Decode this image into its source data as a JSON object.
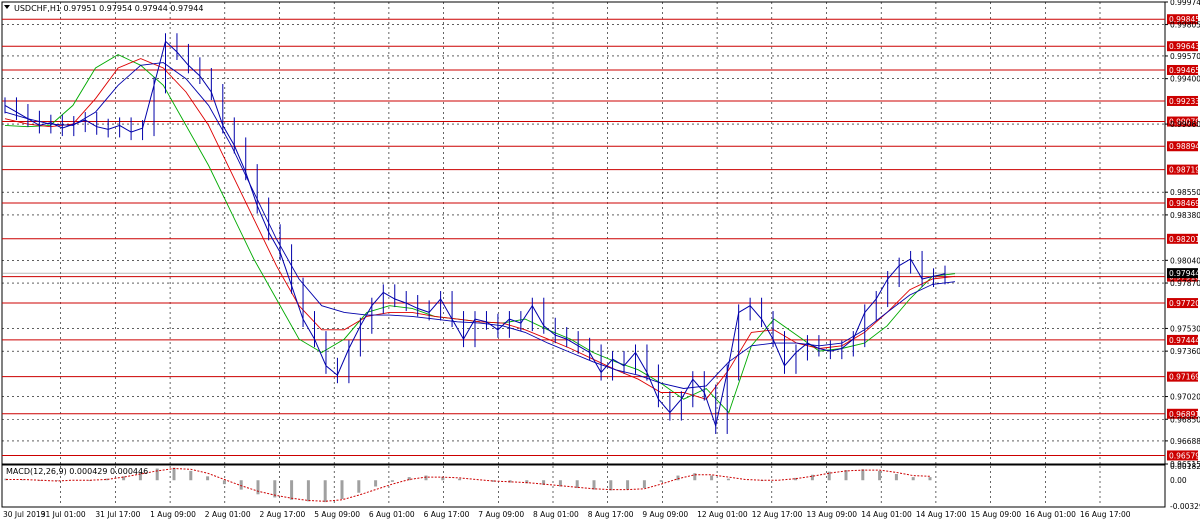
{
  "chart_data": {
    "type": "line",
    "title": "USDCHF,H1  0.97951 0.97954 0.97944 0.97944",
    "symbol": "USDCHF",
    "timeframe": "H1",
    "ohlc": [
      0.97951,
      0.97954,
      0.97944,
      0.97944
    ],
    "ylim": [
      0.96515,
      0.99974
    ],
    "price_ticks": [
      "0.99974",
      "0.99805",
      "0.99570",
      "0.99400",
      "0.99060",
      "0.98550",
      "0.98380",
      "0.98040",
      "0.97870",
      "0.97530",
      "0.97360",
      "0.97020",
      "0.96850",
      "0.96688",
      "0.96515"
    ],
    "time_labels": [
      "30 Jul 2019",
      "31 Jul 01:00",
      "31 Jul 17:00",
      "1 Aug 09:00",
      "2 Aug 01:00",
      "2 Aug 17:00",
      "5 Aug 09:00",
      "6 Aug 01:00",
      "6 Aug 17:00",
      "7 Aug 09:00",
      "8 Aug 01:00",
      "8 Aug 17:00",
      "9 Aug 09:00",
      "12 Aug 01:00",
      "12 Aug 17:00",
      "13 Aug 09:00",
      "14 Aug 01:00",
      "14 Aug 17:00",
      "15 Aug 09:00",
      "16 Aug 01:00",
      "16 Aug 17:00"
    ],
    "levels": [
      "0.99845",
      "0.99643",
      "0.99465",
      "0.99233",
      "0.99079",
      "0.98894",
      "0.98719",
      "0.98469",
      "0.98201",
      "0.97918",
      "0.97720",
      "0.97444",
      "0.97169",
      "0.96891",
      "0.96579"
    ],
    "current_price": "0.97944",
    "price_series": [
      0.992,
      0.9915,
      0.991,
      0.9905,
      0.9907,
      0.9903,
      0.9906,
      0.9909,
      0.9904,
      0.9902,
      0.9905,
      0.99,
      0.9903,
      0.9935,
      0.9968,
      0.996,
      0.995,
      0.9942,
      0.993,
      0.9905,
      0.989,
      0.987,
      0.9845,
      0.9825,
      0.981,
      0.9785,
      0.976,
      0.9745,
      0.9725,
      0.9718,
      0.9738,
      0.9755,
      0.977,
      0.978,
      0.9775,
      0.9772,
      0.9768,
      0.9765,
      0.9775,
      0.976,
      0.9745,
      0.976,
      0.9758,
      0.9752,
      0.976,
      0.9757,
      0.977,
      0.9755,
      0.9748,
      0.9745,
      0.974,
      0.9735,
      0.972,
      0.973,
      0.9725,
      0.9735,
      0.972,
      0.97,
      0.969,
      0.97,
      0.9715,
      0.9705,
      0.968,
      0.972,
      0.9765,
      0.977,
      0.976,
      0.9745,
      0.9725,
      0.9735,
      0.9742,
      0.9738,
      0.9736,
      0.9738,
      0.9745,
      0.9765,
      0.9775,
      0.979,
      0.98,
      0.9805,
      0.979,
      0.9792,
      0.9794
    ],
    "ma_series": [
      {
        "color": "#00aa00",
        "values": [
          0.9905,
          0.9904,
          0.9905,
          0.992,
          0.9948,
          0.9958,
          0.995,
          0.9935,
          0.9905,
          0.9875,
          0.984,
          0.9805,
          0.9775,
          0.9745,
          0.9735,
          0.9745,
          0.9765,
          0.977,
          0.9768,
          0.9762,
          0.976,
          0.9758,
          0.9757,
          0.976,
          0.9752,
          0.9745,
          0.9735,
          0.9728,
          0.9722,
          0.9712,
          0.97,
          0.9708,
          0.969,
          0.974,
          0.976,
          0.9748,
          0.9736,
          0.9738,
          0.9742,
          0.9755,
          0.9775,
          0.9792,
          0.9794
        ]
      },
      {
        "color": "#dd0000",
        "values": [
          0.991,
          0.9906,
          0.9904,
          0.9906,
          0.9925,
          0.9948,
          0.9955,
          0.9948,
          0.993,
          0.9905,
          0.987,
          0.9835,
          0.98,
          0.977,
          0.9752,
          0.9752,
          0.9762,
          0.9765,
          0.9765,
          0.9762,
          0.976,
          0.9758,
          0.9757,
          0.9752,
          0.9745,
          0.9738,
          0.973,
          0.9722,
          0.9715,
          0.9705,
          0.9705,
          0.97,
          0.9722,
          0.975,
          0.9752,
          0.9742,
          0.9738,
          0.974,
          0.975,
          0.9765,
          0.9782,
          0.979,
          0.9792
        ]
      },
      {
        "color": "#0000aa",
        "values": [
          0.9915,
          0.991,
          0.9906,
          0.9905,
          0.9915,
          0.9935,
          0.995,
          0.9952,
          0.994,
          0.992,
          0.989,
          0.9855,
          0.982,
          0.979,
          0.977,
          0.9765,
          0.9763,
          0.9763,
          0.9762,
          0.976,
          0.9758,
          0.9757,
          0.9755,
          0.975,
          0.9742,
          0.9735,
          0.9728,
          0.9722,
          0.9718,
          0.9712,
          0.9708,
          0.971,
          0.9728,
          0.974,
          0.9742,
          0.9742,
          0.974,
          0.9742,
          0.9752,
          0.9765,
          0.9778,
          0.9786,
          0.9788
        ]
      }
    ],
    "macd": {
      "label": "MACD(12,26,9) 0.000429 0.000446",
      "ylim": [
        -0.003298,
        0.001824
      ],
      "ticks": [
        "0.001824",
        "0.00",
        "-0.003298"
      ],
      "histogram": [
        0.0002,
        0.0001,
        -0.0001,
        -0.0001,
        0.0,
        -0.0001,
        0.0002,
        0.0005,
        0.001,
        0.0015,
        0.0016,
        0.0012,
        0.0005,
        -0.0005,
        -0.0012,
        -0.0018,
        -0.0022,
        -0.0025,
        -0.0027,
        -0.0028,
        -0.0024,
        -0.0016,
        -0.0008,
        -0.0002,
        0.0004,
        0.0006,
        0.0004,
        0.0002,
        0.0,
        -0.0002,
        -0.0003,
        -0.0004,
        -0.0006,
        -0.0008,
        -0.001,
        -0.0012,
        -0.0013,
        -0.0012,
        -0.001,
        -0.0002,
        0.0006,
        0.0009,
        0.0006,
        0.0002,
        0.0,
        -0.0001,
        0.0,
        0.0003,
        0.0007,
        0.0011,
        0.0013,
        0.0014,
        0.0012,
        0.0008,
        0.0004,
        0.0004
      ],
      "signal": [
        0.0001,
        0.0001,
        0.0,
        -0.0001,
        0.0,
        0.0,
        0.0001,
        0.0004,
        0.0008,
        0.0012,
        0.0015,
        0.0014,
        0.0009,
        0.0001,
        -0.0007,
        -0.0014,
        -0.0019,
        -0.0023,
        -0.0026,
        -0.0027,
        -0.0025,
        -0.0019,
        -0.0012,
        -0.0005,
        0.0001,
        0.0004,
        0.0004,
        0.0003,
        0.0001,
        -0.0001,
        -0.0002,
        -0.0003,
        -0.0005,
        -0.0007,
        -0.0009,
        -0.0011,
        -0.0012,
        -0.0012,
        -0.0011,
        -0.0005,
        0.0002,
        0.0007,
        0.0007,
        0.0004,
        0.0001,
        0.0,
        0.0,
        0.0002,
        0.0005,
        0.0009,
        0.0012,
        0.0013,
        0.0013,
        0.001,
        0.0006,
        0.0005
      ]
    },
    "colors": {
      "background": "#ffffff",
      "grid": "#000000",
      "price": "#0000aa",
      "level": "#cc0000",
      "level_label_bg": "#cc0000",
      "macd_signal": "#cc0000",
      "macd_histogram": "#a0a0a0"
    },
    "grid": true
  }
}
